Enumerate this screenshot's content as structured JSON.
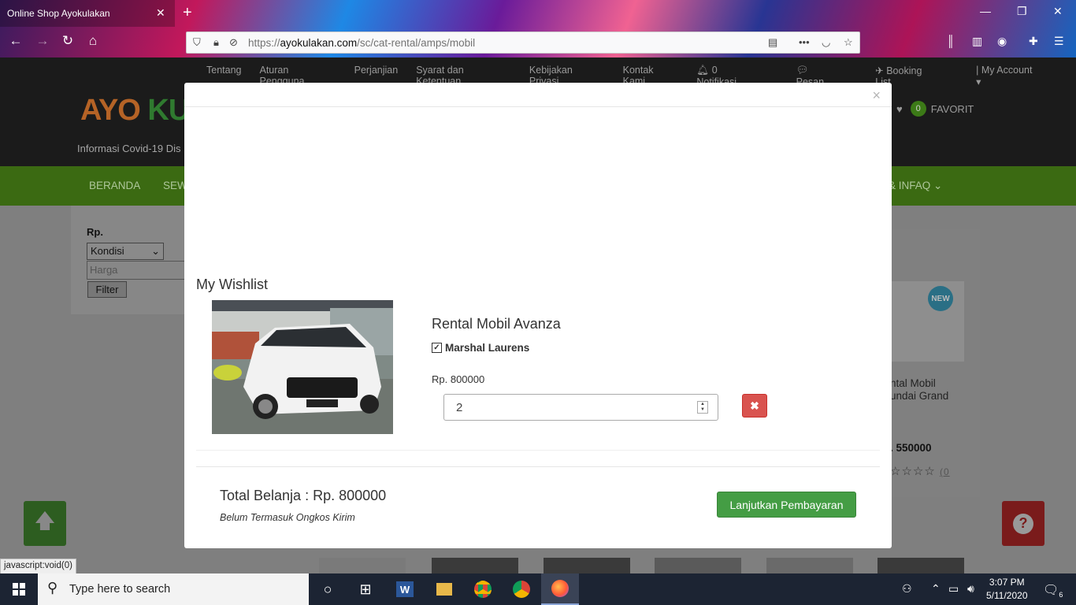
{
  "browser": {
    "tab_title": "Online Shop Ayokulakan",
    "url_domain": "ayokulakan.com",
    "url_prefix": "https://",
    "url_path": "/sc/cat-rental/amps/mobil",
    "status_url": "javascript:void(0)"
  },
  "site": {
    "topnav": [
      "Tentang",
      "Aturan Pengguna",
      "Perjanjian",
      "Syarat dan Ketentuan",
      "Kebijakan Privasi",
      "Kontak Kami",
      "0 Notifikasi",
      "Pesan",
      "Booking List",
      "| My Account"
    ],
    "logo_a": "AYO",
    "logo_b": "KULAK",
    "covid_text": "Informasi Covid-19 Dis",
    "fav_count": "0",
    "fav_label": "FAVORIT",
    "nav": {
      "home": "BERANDA",
      "sewa": "SEW",
      "infaq": "& INFAQ"
    },
    "sidebar": {
      "label": "Rp.",
      "select": "Kondisi",
      "harga_placeholder": "Harga",
      "filter": "Filter"
    },
    "card": {
      "badge": "NEW",
      "title_line1": "ntal Mobil",
      "title_line2": "undai Grand",
      "price": ". 550000",
      "stars": "☆☆☆☆",
      "count": "(0"
    }
  },
  "modal": {
    "close": "×",
    "title": "My Wishlist",
    "product_name": "Rental Mobil Avanza",
    "seller": "Marshal Laurens",
    "price": "Rp. 800000",
    "quantity": "2",
    "total": "Total Belanja : Rp. 800000",
    "total_note": "Belum Termasuk Ongkos Kirim",
    "pay_button": "Lanjutkan Pembayaran"
  },
  "taskbar": {
    "search_placeholder": "Type here to search",
    "time": "3:07 PM",
    "date": "5/11/2020",
    "notif_count": "6"
  },
  "colors": {
    "pay_green": "#449d44",
    "delete_red": "#d9534f",
    "nav_green": "#3b6a12"
  }
}
